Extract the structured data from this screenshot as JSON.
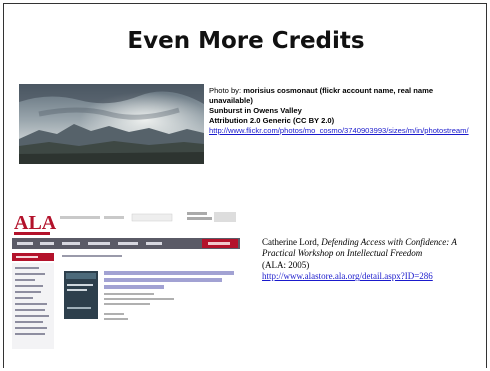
{
  "slide": {
    "title": "Even More Credits"
  },
  "credit1": {
    "prefix": "Photo by: ",
    "author": "morisius cosmonaut (flickr account name, real name unavailable)",
    "photo_title": "Sunburst in Owens Valley",
    "license": "Attribution 2.0 Generic (CC BY 2.0)",
    "url": " http://www.flickr.com/photos/mo_cosmo/3740903993/sizes/m/in/photostream/"
  },
  "credit2": {
    "author": "Catherine Lord, ",
    "book_title": "Defending Access with Confidence: A Practical Workshop on Intellectual Freedom",
    "publisher": "(ALA: 2005)",
    "url": "http://www.alastore.ala.org/detail.aspx?ID=286"
  },
  "ala_screenshot": {
    "logo": "ALA",
    "product_title": "Defending Access with Confidence: A Practical Workshop on Intellectual Freedom"
  },
  "colors": {
    "link": "#1a1acc",
    "ala_red": "#b3122b",
    "nav_dark": "#5a5a66"
  }
}
